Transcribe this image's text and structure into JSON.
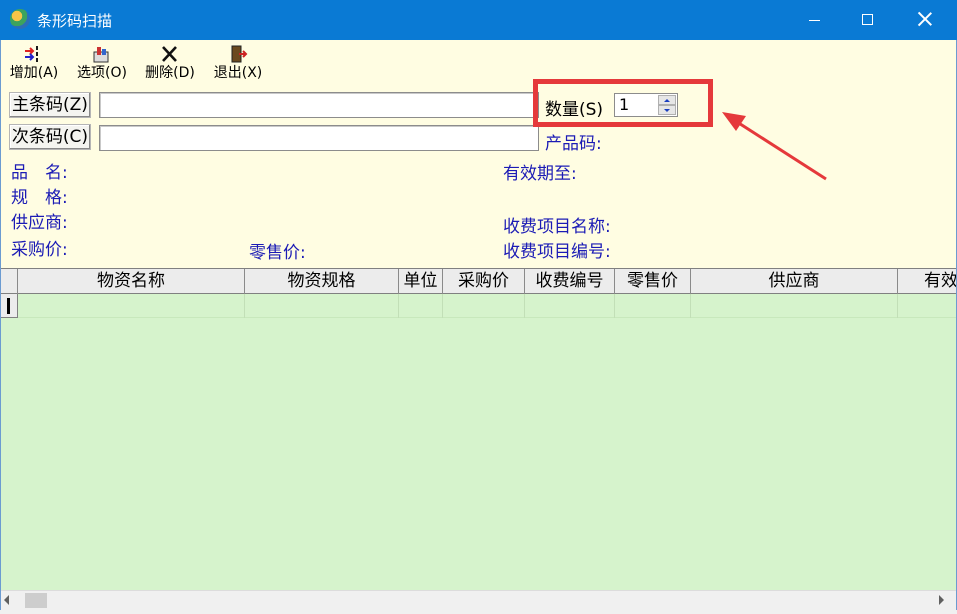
{
  "window": {
    "title": "条形码扫描",
    "title_bar_color": "#0a7ad4"
  },
  "toolbar": {
    "add_label": "增加(A)",
    "options_label": "选项(O)",
    "delete_label": "删除(D)",
    "exit_label": "退出(X)"
  },
  "form": {
    "primary_barcode_button": "主条码(Z)",
    "primary_barcode_value": "",
    "secondary_barcode_button": "次条码(C)",
    "secondary_barcode_value": "",
    "quantity_label": "数量(S)",
    "quantity_value": "1",
    "product_code_label": "产品码:",
    "name_label": "品　名:",
    "spec_label": "规　格:",
    "supplier_label": "供应商:",
    "purchase_price_label": "采购价:",
    "retail_price_label": "零售价:",
    "expiry_label": "有效期至:",
    "charge_item_name_label": "收费项目名称:",
    "charge_item_code_label": "收费项目编号:"
  },
  "grid": {
    "columns": [
      "物资名称",
      "物资规格",
      "单位",
      "采购价",
      "收费编号",
      "零售价",
      "供应商",
      "有效"
    ],
    "rows": [
      [
        "",
        "",
        "",
        "",
        "",
        "",
        "",
        ""
      ]
    ]
  },
  "colors": {
    "form_background": "#fffde2",
    "grid_background": "#d6f3cc",
    "label_blue": "#1b1bb5",
    "highlight_red": "#e5393b"
  },
  "icons": {
    "add": "add-icon",
    "options": "options-icon",
    "delete": "delete-icon",
    "exit": "exit-door-icon"
  }
}
